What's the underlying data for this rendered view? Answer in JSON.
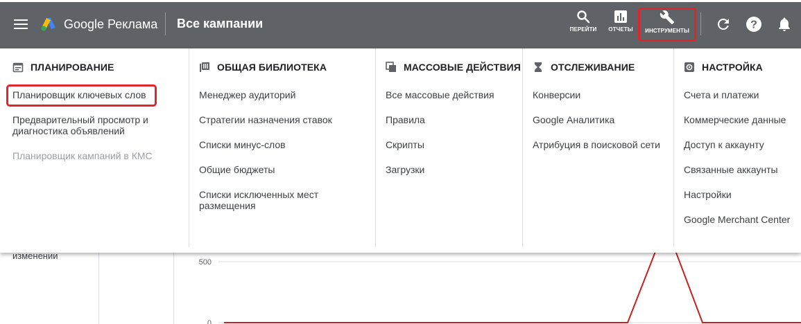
{
  "topbar": {
    "brand": "Google Реклама",
    "title": "Все кампании",
    "tools": [
      {
        "label": "ПЕРЕЙТИ",
        "icon": "search-icon"
      },
      {
        "label": "ОТЧЕТЫ",
        "icon": "reports-icon"
      },
      {
        "label": "ИНСТРУМЕНТЫ",
        "icon": "wrench-icon"
      }
    ],
    "icons": [
      "menu-icon",
      "refresh-icon",
      "help-icon",
      "bell-icon"
    ]
  },
  "menu": {
    "columns": [
      {
        "heading": "ПЛАНИРОВАНИЕ",
        "icon": "calendar-icon",
        "items": [
          {
            "label": "Планировщик ключевых слов",
            "enabled": true
          },
          {
            "label": "Предварительный просмотр и диагностика объявлений",
            "enabled": true
          },
          {
            "label": "Планировщик кампаний в КМС",
            "enabled": false
          }
        ]
      },
      {
        "heading": "ОБЩАЯ БИБЛИОТЕКА",
        "icon": "library-icon",
        "items": [
          {
            "label": "Менеджер аудиторий"
          },
          {
            "label": "Стратегии назначения ставок"
          },
          {
            "label": "Списки минус-слов"
          },
          {
            "label": "Общие бюджеты"
          },
          {
            "label": "Списки исключенных мест размещения"
          }
        ]
      },
      {
        "heading": "МАССОВЫЕ ДЕЙСТВИЯ",
        "icon": "bulk-actions-icon",
        "items": [
          {
            "label": "Все массовые действия"
          },
          {
            "label": "Правила"
          },
          {
            "label": "Скрипты"
          },
          {
            "label": "Загрузки"
          }
        ]
      },
      {
        "heading": "ОТСЛЕЖИВАНИЕ",
        "icon": "hourglass-icon",
        "items": [
          {
            "label": "Конверсии"
          },
          {
            "label": "Google Аналитика"
          },
          {
            "label": "Атрибуция в поисковой сети"
          }
        ]
      },
      {
        "heading": "НАСТРОЙКА",
        "icon": "settings-icon",
        "items": [
          {
            "label": "Счета и платежи"
          },
          {
            "label": "Коммерческие данные"
          },
          {
            "label": "Доступ к аккаунту"
          },
          {
            "label": "Связанные аккаунты"
          },
          {
            "label": "Настройки"
          },
          {
            "label": "Google Merchant Center"
          }
        ]
      }
    ]
  },
  "background": {
    "sidebar_text": "изменении",
    "chart_data": {
      "type": "line",
      "y_ticks": [
        "500",
        "0"
      ],
      "ylim": [
        0,
        500
      ],
      "series": [
        {
          "color": "#c5221f",
          "values": [
            0,
            0,
            0,
            0,
            0,
            0,
            0,
            0,
            0,
            0,
            0,
            800,
            0,
            0,
            0
          ]
        }
      ]
    }
  },
  "colors": {
    "topbar": "#5f6368",
    "highlight": "#e0262b",
    "chart_line": "#c5221f"
  }
}
